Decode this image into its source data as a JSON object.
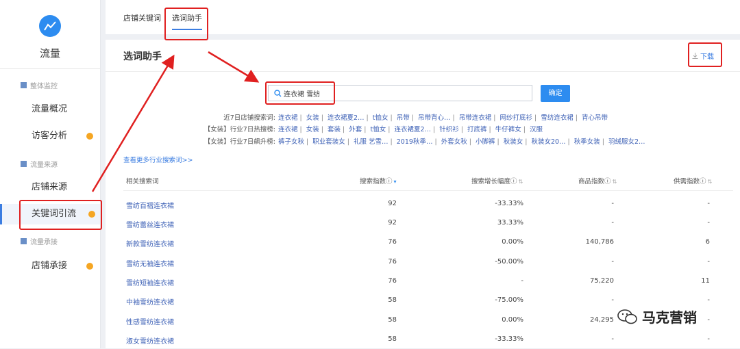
{
  "sidebar": {
    "app_title": "流量",
    "groups": [
      {
        "label": "整体监控"
      },
      {
        "label": "流量来源"
      },
      {
        "label": "流量承接"
      }
    ],
    "items": [
      {
        "label": "流量概况"
      },
      {
        "label": "访客分析"
      },
      {
        "label": "店铺来源"
      },
      {
        "label": "关键词引流"
      },
      {
        "label": "店铺承接"
      }
    ]
  },
  "tabs": [
    {
      "label": "店铺关键词"
    },
    {
      "label": "选词助手"
    }
  ],
  "panel": {
    "title": "选词助手",
    "download_label": "下载",
    "search_value": "连衣裙 雪纺",
    "confirm_label": "确定",
    "more_link": "查看更多行业搜索词>>"
  },
  "keyword_rows": [
    {
      "label": "近7日店铺搜索词:",
      "words": [
        "连衣裙",
        "女装",
        "连衣裙夏2…",
        "t恤女",
        "吊带",
        "吊带背心…",
        "吊带连衣裙",
        "网纱打底衫",
        "雪纺连衣裙",
        "背心吊带"
      ]
    },
    {
      "label": "【女装】行业7日热搜榜:",
      "words": [
        "连衣裙",
        "女装",
        "套装",
        "外套",
        "t恤女",
        "连衣裙夏2…",
        "针织衫",
        "打底裤",
        "牛仔裤女",
        "汉服"
      ]
    },
    {
      "label": "【女装】行业7日飙升榜:",
      "words": [
        "裤子女秋",
        "职业套装女",
        "礼服 艺雪…",
        "2019秋季…",
        "外套女秋",
        "小脚裤",
        "秋装女",
        "秋装女20…",
        "秋季女装",
        "羽绒服女2…"
      ]
    }
  ],
  "table": {
    "headers": {
      "keyword": "相关搜索词",
      "search": "搜索指数",
      "growth": "搜索增长幅度",
      "goods": "商品指数",
      "supply": "供需指数"
    },
    "rows": [
      {
        "keyword": "雪纺百褶连衣裙",
        "search": "92",
        "growth": "-33.33%",
        "goods": "-",
        "supply": "-"
      },
      {
        "keyword": "雪纺蕾丝连衣裙",
        "search": "92",
        "growth": "33.33%",
        "goods": "-",
        "supply": "-"
      },
      {
        "keyword": "新款雪纺连衣裙",
        "search": "76",
        "growth": "0.00%",
        "goods": "140,786",
        "supply": "6"
      },
      {
        "keyword": "雪纺无袖连衣裙",
        "search": "76",
        "growth": "-50.00%",
        "goods": "-",
        "supply": "-"
      },
      {
        "keyword": "雪纺短袖连衣裙",
        "search": "76",
        "growth": "-",
        "goods": "75,220",
        "supply": "11"
      },
      {
        "keyword": "中袖雪纺连衣裙",
        "search": "58",
        "growth": "-75.00%",
        "goods": "-",
        "supply": "-"
      },
      {
        "keyword": "性感雪纺连衣裙",
        "search": "58",
        "growth": "0.00%",
        "goods": "24,295",
        "supply": "-"
      },
      {
        "keyword": "淑女雪纺连衣裙",
        "search": "58",
        "growth": "-33.33%",
        "goods": "-",
        "supply": "-"
      }
    ]
  },
  "brand_watermark": "马克营销",
  "colors": {
    "accent": "#2d8cf0",
    "annotation": "#e02020",
    "badge": "#f5a623"
  }
}
